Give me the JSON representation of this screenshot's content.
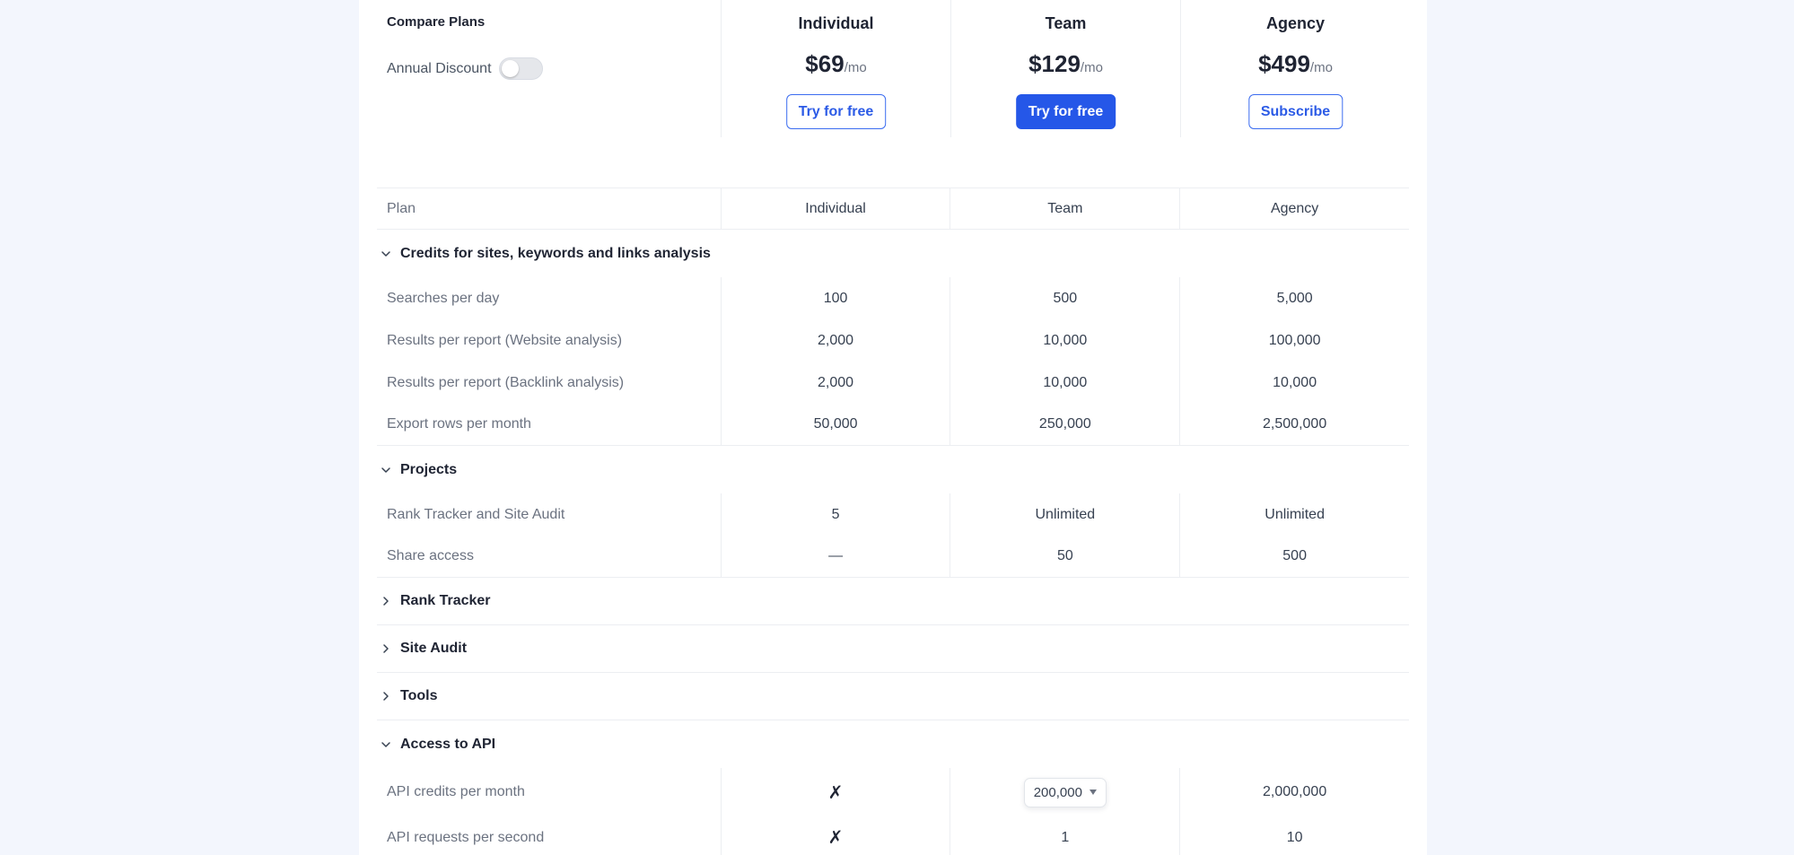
{
  "header": {
    "title": "Compare Plans",
    "annual_discount_label": "Annual Discount",
    "annual_discount_on": false
  },
  "plans": [
    {
      "name": "Individual",
      "price": "$69",
      "per": "/mo",
      "button": "Try for free",
      "button_style": "outline"
    },
    {
      "name": "Team",
      "price": "$129",
      "per": "/mo",
      "button": "Try for free",
      "button_style": "solid"
    },
    {
      "name": "Agency",
      "price": "$499",
      "per": "/mo",
      "button": "Subscribe",
      "button_style": "outline"
    }
  ],
  "table_header": {
    "label": "Plan",
    "cols": [
      "Individual",
      "Team",
      "Agency"
    ]
  },
  "sections": {
    "credits": {
      "title": "Credits for sites, keywords and links analysis",
      "expanded": true,
      "rows": [
        {
          "label": "Searches per day",
          "values": [
            "100",
            "500",
            "5,000"
          ]
        },
        {
          "label": "Results per report (Website analysis)",
          "values": [
            "2,000",
            "10,000",
            "100,000"
          ]
        },
        {
          "label": "Results per report (Backlink analysis)",
          "values": [
            "2,000",
            "10,000",
            "10,000"
          ]
        },
        {
          "label": "Export rows per month",
          "values": [
            "50,000",
            "250,000",
            "2,500,000"
          ]
        }
      ]
    },
    "projects": {
      "title": "Projects",
      "expanded": true,
      "rows": [
        {
          "label": "Rank Tracker and Site Audit",
          "values": [
            "5",
            "Unlimited",
            "Unlimited"
          ]
        },
        {
          "label": "Share access",
          "values": [
            "—",
            "50",
            "500"
          ]
        }
      ]
    },
    "rank_tracker": {
      "title": "Rank Tracker",
      "expanded": false
    },
    "site_audit": {
      "title": "Site Audit",
      "expanded": false
    },
    "tools": {
      "title": "Tools",
      "expanded": false
    },
    "api": {
      "title": "Access to API",
      "expanded": true,
      "rows": [
        {
          "label": "API credits per month",
          "values": [
            "✗",
            "200,000",
            "2,000,000"
          ]
        },
        {
          "label": "API requests per second",
          "values": [
            "✗",
            "1",
            "10"
          ]
        }
      ]
    }
  },
  "icons": {
    "chevron_down": "chevron-down-icon",
    "chevron_right": "chevron-right-icon",
    "caret_down": "caret-down-icon",
    "cross": "cross-icon"
  },
  "colors": {
    "accent": "#2557e8",
    "page_bg": "#f3f6fd"
  }
}
